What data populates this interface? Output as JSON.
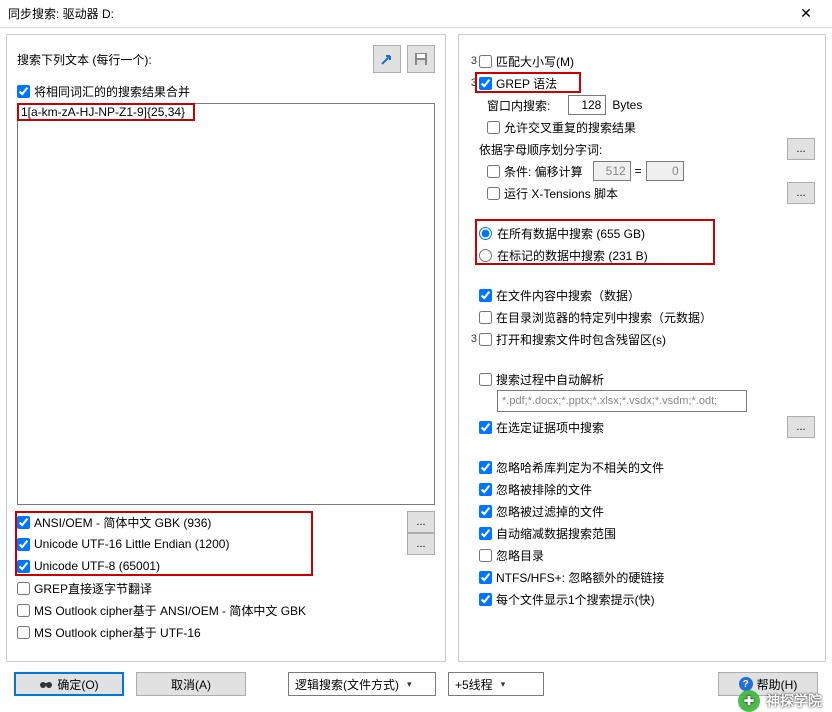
{
  "title": "同步搜索: 驱动器 D:",
  "left": {
    "header": "搜索下列文本 (每行一个):",
    "merge": "将相同词汇的的搜索结果合并",
    "regex": "1[a-km-zA-HJ-NP-Z1-9]{25,34}",
    "enc1": "ANSI/OEM - 简体中文 GBK (936)",
    "enc2": "Unicode UTF-16 Little Endian (1200)",
    "enc3": "Unicode UTF-8 (65001)",
    "grep": "GREP直接逐字节翻译",
    "out1": "MS Outlook cipher基于 ANSI/OEM - 简体中文 GBK",
    "out2": "MS Outlook cipher基于 UTF-16"
  },
  "right": {
    "matchCase": "匹配大小写(M)",
    "grepSyntax": "GREP 语法",
    "windowSearch": "窗口内搜索:",
    "windowBytes": "128",
    "bytesLabel": "Bytes",
    "allowDup": "允许交叉重复的搜索结果",
    "alphaSplit": "依据字母顺序划分字词:",
    "cond": "条件: 偏移计算",
    "condV1": "512",
    "condV2": "0",
    "runXT": "运行 X-Tensions 脚本",
    "radioAll": "在所有数据中搜索 (655 GB)",
    "radioMarked": "在标记的数据中搜索 (231 B)",
    "inContent": "在文件内容中搜索（数据）",
    "inDirCols": "在目录浏览器的特定列中搜索（元数据）",
    "openSlack": "打开和搜索文件时包含残留区(s)",
    "autoParse": "搜索过程中自动解析",
    "parseExts": "*.pdf;*.docx;*.pptx;*.xlsx;*.vsdx;*.vsdm;*.odt;",
    "inEvidence": "在选定证据项中搜索",
    "ignoreHash": "忽略哈希库判定为不相关的文件",
    "ignoreExcluded": "忽略被排除的文件",
    "ignoreFiltered": "忽略被过滤掉的文件",
    "autoShrink": "自动缩减数据搜索范围",
    "ignoreDirs": "忽略目录",
    "ntfsHfs": "NTFS/HFS+: 忽略额外的硬链接",
    "perFileHint": "每个文件显示1个搜索提示(快)"
  },
  "footer": {
    "ok": "确定(O)",
    "cancel": "取消(A)",
    "mode": "逻辑搜索(文件方式)",
    "threads": "+5线程",
    "help": "帮助(H)"
  }
}
